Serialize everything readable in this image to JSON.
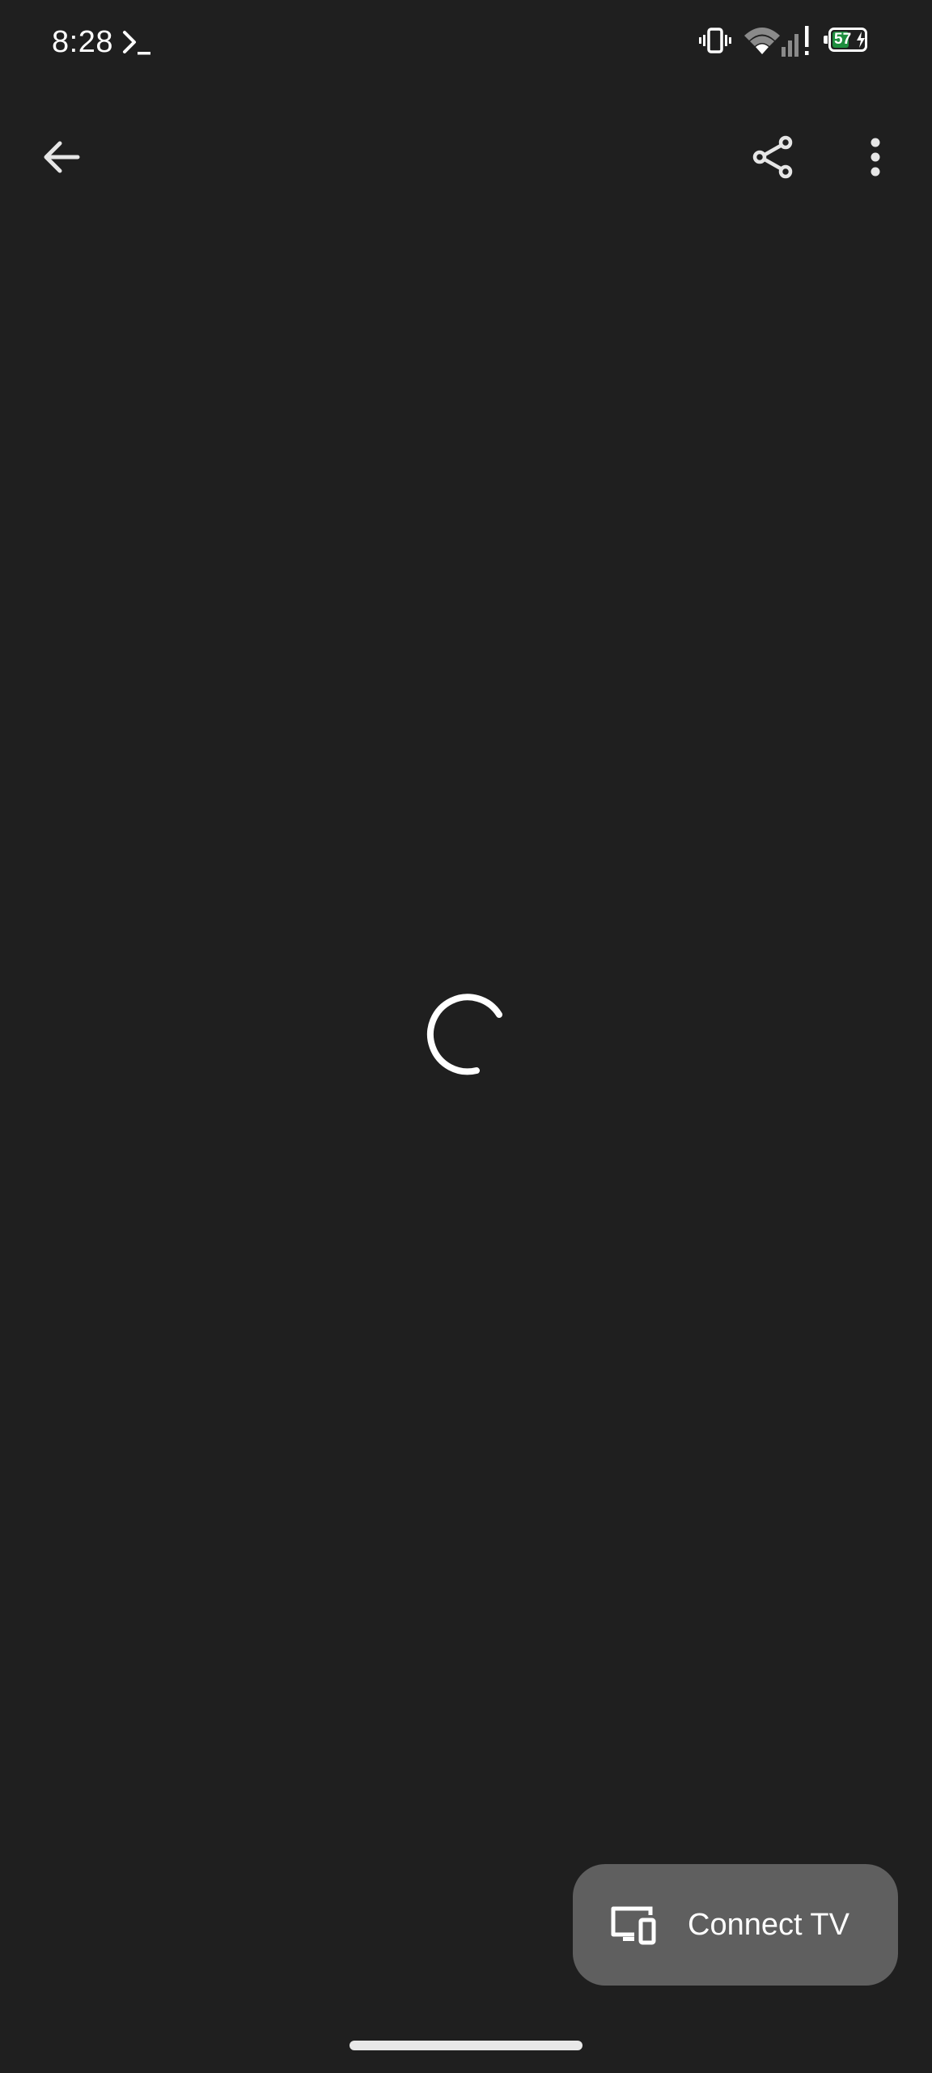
{
  "status_bar": {
    "time": "8:28",
    "battery_level": "57",
    "battery_percent_value": 57,
    "battery_color": "#1e8e3e",
    "icons": [
      "terminal-icon",
      "vibrate-icon",
      "wifi-icon",
      "signal-icon",
      "battery-icon",
      "bolt-icon"
    ]
  },
  "app_bar": {
    "icons": [
      "back-arrow-icon",
      "share-icon",
      "more-vert-icon"
    ]
  },
  "content": {
    "loading": true,
    "spinner_icon": "loading-spinner-icon"
  },
  "connect_tv": {
    "label": "Connect TV",
    "icon": "cast-devices-icon",
    "background": "#5f5f5f"
  },
  "theme": {
    "background": "#1f1f1f",
    "foreground": "#ffffff"
  }
}
